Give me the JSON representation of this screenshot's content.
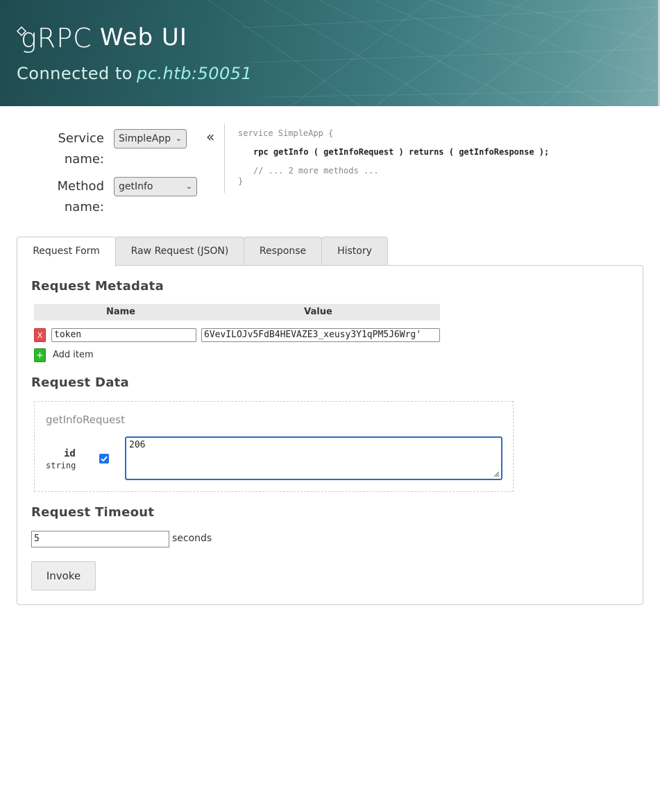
{
  "header": {
    "logo_text": "gRPC",
    "app_title": "Web UI",
    "connected_label": "Connected to",
    "host": "pc.htb:50051"
  },
  "selection": {
    "service_label_line1": "Service",
    "service_label_line2": "name:",
    "service_value": "SimpleApp",
    "method_label_line1": "Method",
    "method_label_line2": "name:",
    "method_value": "getInfo",
    "collapse_icon": "«"
  },
  "proto": {
    "line1": "service SimpleApp {",
    "rpc_line": "rpc getInfo ( getInfoRequest ) returns ( getInfoResponse );",
    "more_line": "// ... 2 more methods ...",
    "close": "}"
  },
  "tabs": [
    {
      "label": "Request Form",
      "active": true
    },
    {
      "label": "Raw Request (JSON)",
      "active": false
    },
    {
      "label": "Response",
      "active": false
    },
    {
      "label": "History",
      "active": false
    }
  ],
  "metadata": {
    "heading": "Request Metadata",
    "col_name": "Name",
    "col_value": "Value",
    "rows": [
      {
        "name": "token",
        "value": "6VevILOJv5FdB4HEVAZE3_xeusy3Y1qPM5J6Wrg'"
      }
    ],
    "remove_label": "X",
    "add_icon": "+",
    "add_label": "Add item"
  },
  "request_data": {
    "heading": "Request Data",
    "message_name": "getInfoRequest",
    "field_name": "id",
    "field_type": "string",
    "field_checked": true,
    "field_value": "206"
  },
  "timeout": {
    "heading": "Request Timeout",
    "value": "5",
    "unit": "seconds"
  },
  "invoke_label": "Invoke",
  "colors": {
    "header_gradient_start": "#1f4b50",
    "header_gradient_end": "#7aa9ac",
    "host_color": "#9ff1e6",
    "remove_button": "#e44c4c",
    "add_button": "#2db82d",
    "focus_border": "#2a6bc4"
  }
}
